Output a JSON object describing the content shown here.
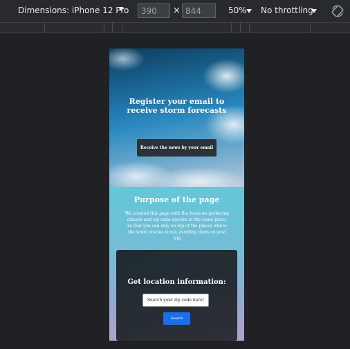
{
  "toolbar": {
    "dimensions_label": "Dimensions: iPhone 12 Pro",
    "width_value": "390",
    "height_value": "844",
    "times_symbol": "×",
    "zoom_label": "50%",
    "throttle_label": "No throttling"
  },
  "page": {
    "hero_title": "Register your email to receive storm forecasts",
    "hero_button": "Receive the news by your email",
    "purpose_title": "Purpose of the page",
    "purpose_text": "We created this page with the focus on gathering climate and zip code queries in the same place, so that you can stay on top of the places where the worst storms occur, avoiding them on your trip",
    "card_title": "Get location information:",
    "zip_placeholder": "Search your zip code here!",
    "search_button": "Search"
  },
  "icons": {
    "dimensions_dropdown": "caret-down-icon",
    "zoom_dropdown": "caret-down-icon",
    "throttle_dropdown": "caret-down-icon",
    "rotate": "rotate-icon"
  }
}
